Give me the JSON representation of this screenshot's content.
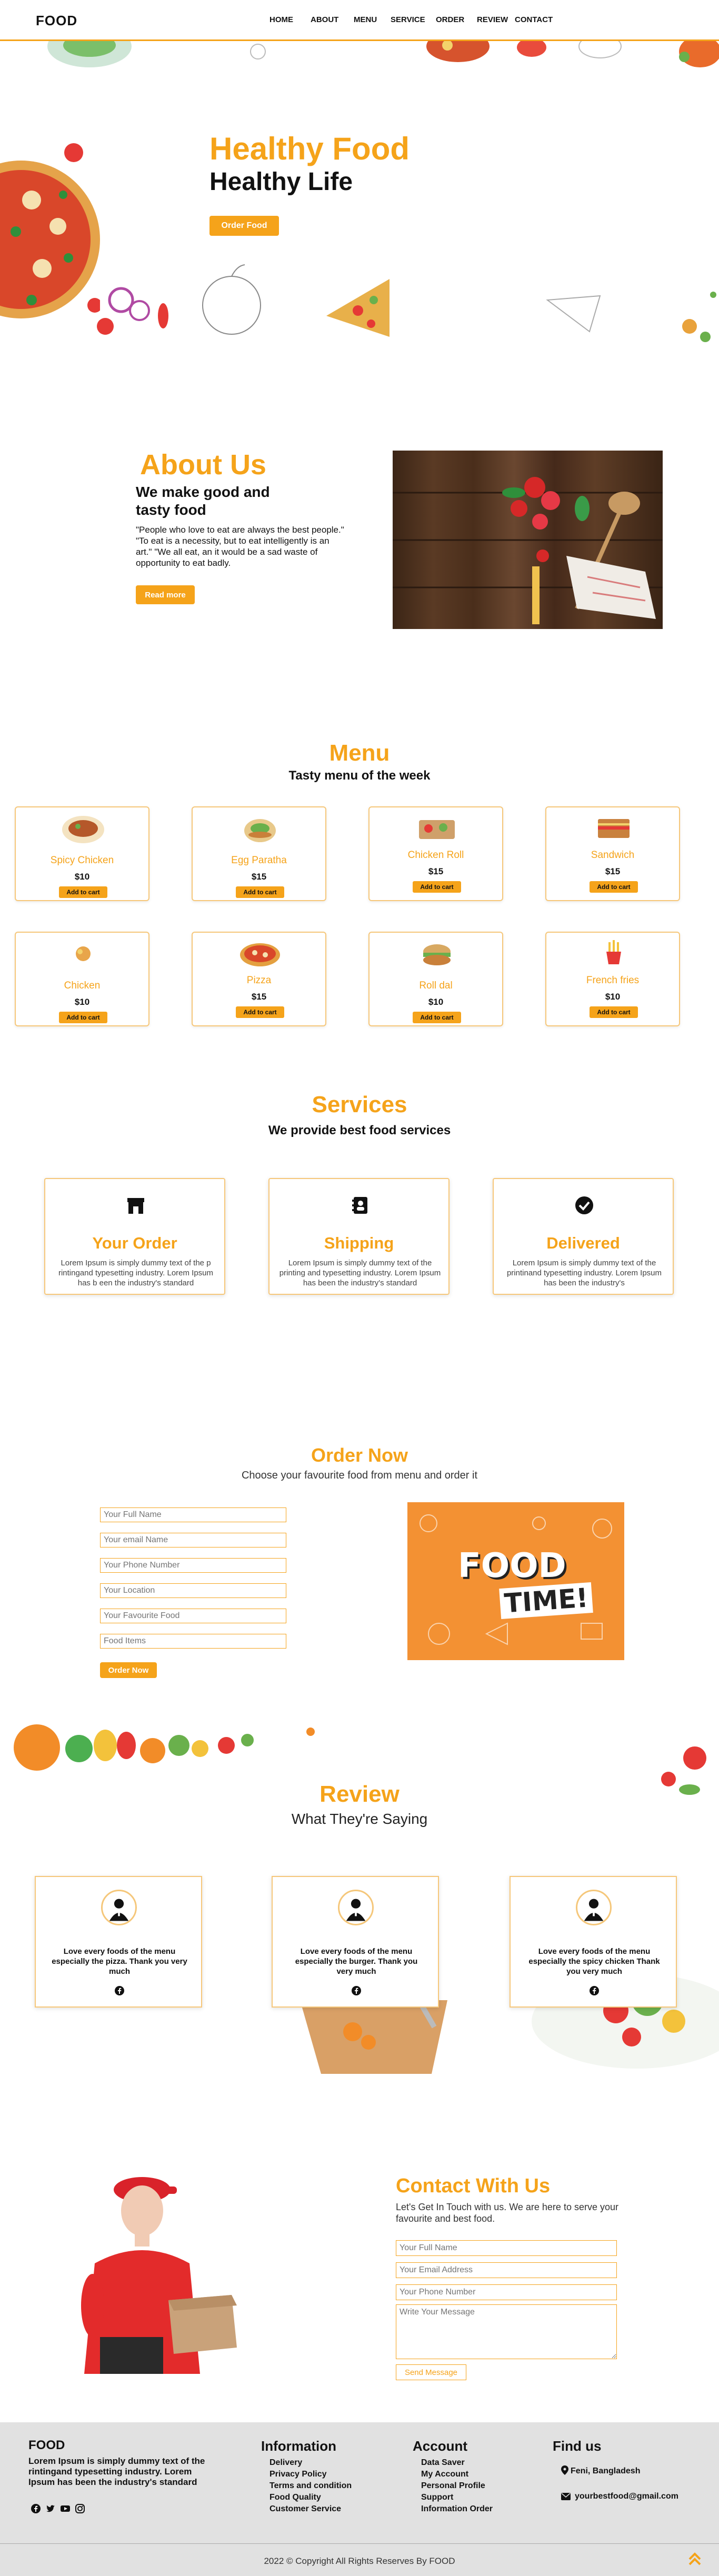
{
  "nav": {
    "logo": "FOOD",
    "items": [
      "HOME",
      "ABOUT",
      "MENU",
      "SERVICE",
      "ORDER",
      "REVIEW",
      "CONTACT"
    ]
  },
  "hero": {
    "title1": "Healthy Food",
    "title2": "Healthy Life",
    "button": "Order Food"
  },
  "about": {
    "title": "About Us",
    "subtitle": "We make good and tasty food",
    "text": "\"People who love to eat are always the best people.\" \"To eat is a necessity, but to eat intelligently is an art.\" \"We all eat, an it would be a sad waste of opportunity to eat badly.",
    "button": "Read more"
  },
  "menu": {
    "title": "Menu",
    "subtitle": "Tasty menu of the week",
    "items": [
      {
        "name": "Spicy Chicken",
        "price": "$10",
        "button": "Add to cart"
      },
      {
        "name": "Egg Paratha",
        "price": "$15",
        "button": "Add to cart"
      },
      {
        "name": "Chicken Roll",
        "price": "$15",
        "button": "Add to cart"
      },
      {
        "name": "Sandwich",
        "price": "$15",
        "button": "Add to cart"
      },
      {
        "name": "Chicken",
        "price": "$10",
        "button": "Add to cart"
      },
      {
        "name": "Pizza",
        "price": "$15",
        "button": "Add to cart"
      },
      {
        "name": "Roll dal",
        "price": "$10",
        "button": "Add to cart"
      },
      {
        "name": "French fries",
        "price": "$10",
        "button": "Add to cart"
      }
    ]
  },
  "services": {
    "title": "Services",
    "subtitle": "We provide best food services",
    "items": [
      {
        "title": "Your Order",
        "text": "Lorem Ipsum is simply dummy text of the p rintingand typesetting industry. Lorem Ipsum has b een the industry's standard",
        "icon": "store-icon"
      },
      {
        "title": "Shipping",
        "text": "Lorem Ipsum is simply dummy text of the printing and typesetting industry. Lorem Ipsum has been the industry's standard",
        "icon": "address-book-icon"
      },
      {
        "title": "Delivered",
        "text": "Lorem Ipsum is simply dummy text of the printinand typesetting industry. Lorem Ipsum has been the industry's",
        "icon": "check-circle-icon"
      }
    ]
  },
  "order": {
    "title": "Order Now",
    "subtitle": "Choose your favourite food from menu and order it",
    "fields": [
      "Your Full Name",
      "Your email Name",
      "Your Phone Number",
      "Your Location",
      "Your Favourite Food",
      "Food Items"
    ],
    "button": "Order Now",
    "banner_line1": "FOOD",
    "banner_line2": "TIME!"
  },
  "review": {
    "title": "Review",
    "subtitle": "What They're Saying",
    "items": [
      {
        "text": "Love every foods of the menu especially the pizza. Thank you very much"
      },
      {
        "text": "Love every foods of the menu especially the burger. Thank you very much"
      },
      {
        "text": "Love every foods of the menu especially the spicy chicken Thank you very much"
      }
    ]
  },
  "contact": {
    "title": "Contact With Us",
    "text": "Let's Get In Touch with us. We are here to serve your favourite and best food.",
    "fields": [
      "Your Full Name",
      "Your Email Address",
      "Your Phone Number"
    ],
    "message_placeholder": "Write Your Message",
    "button": "Send Message"
  },
  "footer": {
    "brand": "FOOD",
    "brand_text": "Lorem Ipsum is simply dummy text of the rintingand typesetting industry. Lorem Ipsum has been the industry's standard",
    "info_title": "Information",
    "info_links": [
      "Delivery",
      "Privacy Policy",
      "Terms and condition",
      "Food Quality",
      "Customer Service"
    ],
    "account_title": "Account",
    "account_links": [
      "Data Saver",
      "My Account",
      "Personal Profile",
      "Support",
      "Information Order"
    ],
    "find_title": "Find us",
    "location": "Feni, Bangladesh",
    "email": "yourbestfood@gmail.com",
    "copyright": "2022 © Copyright All Rights Reserves By FOOD"
  },
  "colors": {
    "accent": "#f5a31a",
    "footer_bg": "#e1e1e1",
    "card_border": "#f6c77a"
  }
}
